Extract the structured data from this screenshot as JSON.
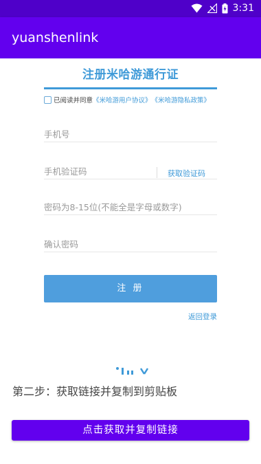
{
  "status": {
    "time": "3:31"
  },
  "app": {
    "title": "yuanshenlink"
  },
  "register": {
    "title": "注册米哈游通行证",
    "agree_text": "已阅读并同意",
    "agree_link_user": "《米哈游用户协议》",
    "agree_link_privacy": "《米哈游隐私政策》",
    "phone_placeholder": "手机号",
    "code_placeholder": "手机验证码",
    "get_code_label": "获取验证码",
    "password_placeholder": "密码为8-15位(不能全是字母或数字)",
    "confirm_placeholder": "确认密码",
    "register_button": "注 册",
    "back_login": "返回登录"
  },
  "step": {
    "text": "第二步：获取链接并复制到剪贴板"
  },
  "copy": {
    "button_label": "点击获取并复制链接"
  },
  "colors": {
    "status_bar": "#4f00c9",
    "app_bar": "#6200ee",
    "accent_blue": "#3f9ad8",
    "button_blue": "#4f9edd"
  },
  "icons": [
    "wifi-icon",
    "signal-icon",
    "battery-icon"
  ]
}
